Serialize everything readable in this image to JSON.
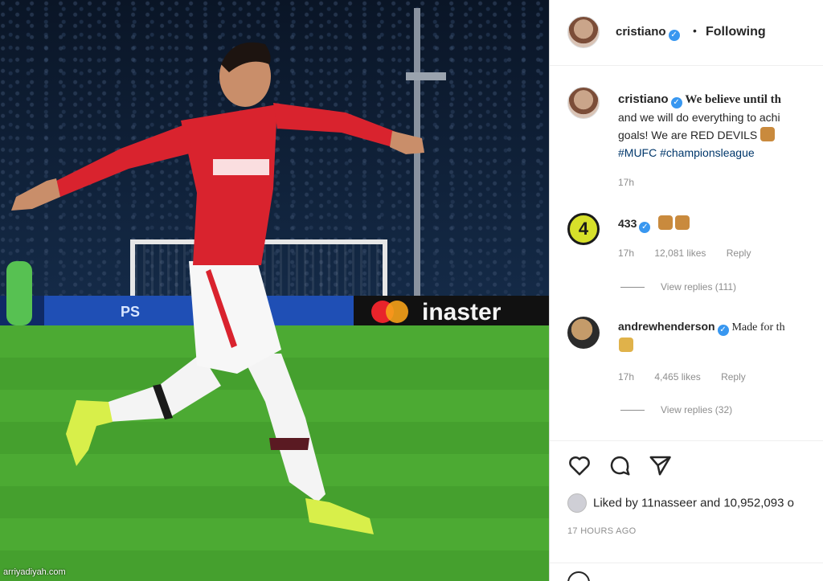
{
  "photo": {
    "ad_left": "PS",
    "ad_right": "inaster",
    "watermark": "arriyadiyah.com"
  },
  "header": {
    "username": "cristiano",
    "separator": "•",
    "follow_status": "Following"
  },
  "caption": {
    "username": "cristiano",
    "line1_bold": "We believe until th",
    "line2": "and we will do everything to achi",
    "line3": "goals! We are RED DEVILS",
    "hashtags": "#MUFC #championsleague",
    "time": "17h"
  },
  "comments": [
    {
      "username": "433",
      "avatar_text": "4",
      "text": "",
      "time": "17h",
      "likes": "12,081 likes",
      "reply": "Reply",
      "view_replies": "View replies (111)"
    },
    {
      "username": "andrewhenderson",
      "text": "Made for th",
      "time": "17h",
      "likes": "4,465 likes",
      "reply": "Reply",
      "view_replies": "View replies (32)"
    }
  ],
  "actions": {
    "icons": [
      "heart-icon",
      "comment-icon",
      "share-icon"
    ]
  },
  "likes": {
    "text": "Liked by 11nasseer and 10,952,093 o"
  },
  "posted_ago": "17 HOURS AGO",
  "colors": {
    "verified": "#3897f0",
    "jersey": "#d9232e",
    "pitch": "#4caa33"
  }
}
